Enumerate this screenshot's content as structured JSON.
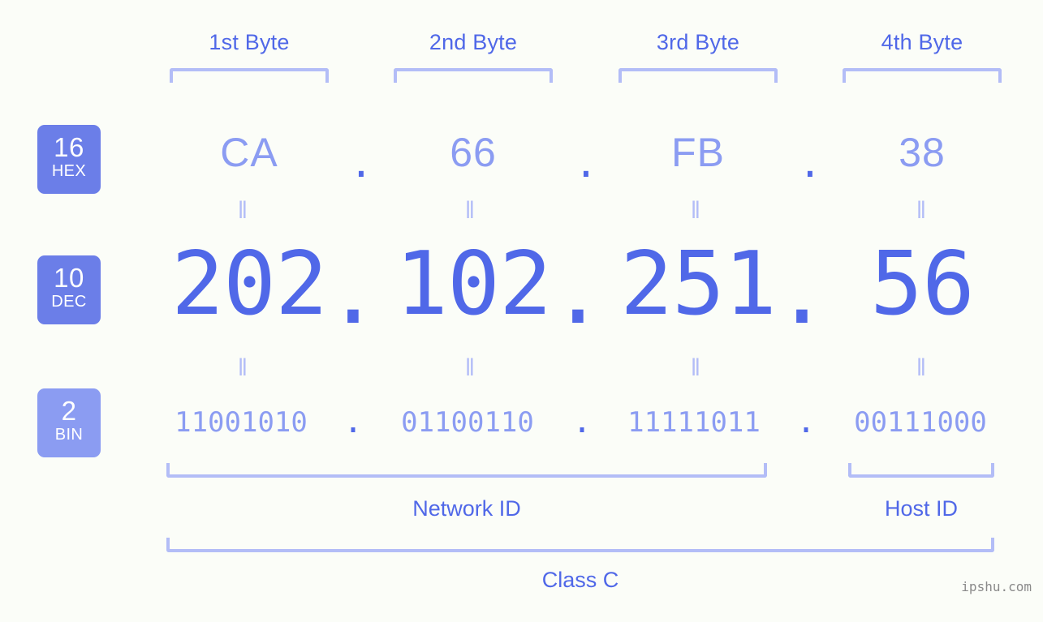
{
  "background_color": "#fbfdf8",
  "accent_color": "#5068e8",
  "accent_light_color": "#8b9cf2",
  "bracket_color": "#b3bdf7",
  "badge_color": "#6b7ee8",
  "byte_headers": [
    {
      "label": "1st Byte"
    },
    {
      "label": "2nd Byte"
    },
    {
      "label": "3rd Byte"
    },
    {
      "label": "4th Byte"
    }
  ],
  "rows": [
    {
      "badge_number": "16",
      "badge_abbr": "HEX",
      "values": [
        "CA",
        "66",
        "FB",
        "38"
      ],
      "separator": "."
    },
    {
      "badge_number": "10",
      "badge_abbr": "DEC",
      "values": [
        "202",
        "102",
        "251",
        "56"
      ],
      "separator": "."
    },
    {
      "badge_number": "2",
      "badge_abbr": "BIN",
      "values": [
        "11001010",
        "01100110",
        "11111011",
        "00111000"
      ],
      "separator": "."
    }
  ],
  "equals_marker": "‖",
  "segments": {
    "network_id_label": "Network ID",
    "host_id_label": "Host ID"
  },
  "class_label": "Class C",
  "watermark": "ipshu.com"
}
